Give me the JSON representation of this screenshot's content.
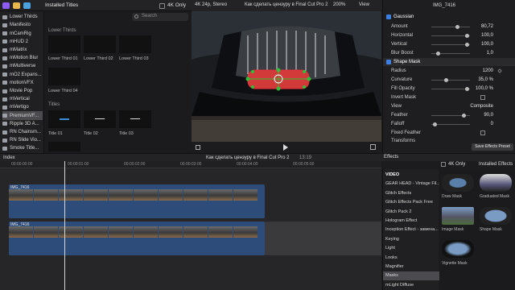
{
  "browser": {
    "title": "Installed Titles",
    "filter_label": "4K Only",
    "search_placeholder": "Search",
    "section_lower_thirds": "Lower Thirds",
    "section_titles": "Titles",
    "lower_thirds": [
      "Lower Third 01",
      "Lower Third 02",
      "Lower Third 03",
      "Lower Third 04"
    ],
    "titles": [
      "Title 01",
      "Title 02",
      "Title 03"
    ]
  },
  "sidebar": {
    "items": [
      "Lower Thirds",
      "Manifesto",
      "mCamRig",
      "mHUD 2",
      "mMatrix",
      "mMotion Blur",
      "mMultiverse",
      "mO2 Expans...",
      "motionVFX",
      "Movie Pop",
      "mVertical",
      "mVertigo",
      "PremiumVF...",
      "Ripple 3D A...",
      "RN Chainsm...",
      "RN Slide Vio...",
      "Smoke Title..."
    ],
    "selected_index": 12
  },
  "viewer": {
    "format": "4K 24p, Stereo",
    "clip_name": "Как сделать цензуру в Final Cut Pro 2",
    "zoom": "200%",
    "view_label": "View"
  },
  "inspector": {
    "clip_name": "IMG_7416",
    "gaussian": {
      "title": "Gaussian",
      "amount_label": "Amount",
      "amount": "80,72",
      "horizontal_label": "Horizontal",
      "horizontal": "100,0",
      "vertical_label": "Vertical",
      "vertical": "100,0",
      "blur_boost_label": "Blur Boost",
      "blur_boost": "1,0"
    },
    "shape_mask": {
      "title": "Shape Mask",
      "radius_label": "Radius",
      "radius": "1200",
      "curvature_label": "Curvature",
      "curvature": "35,0 %",
      "fill_opacity_label": "Fill Opacity",
      "fill_opacity": "100,0 %",
      "invert_label": "Invert Mask",
      "view_label": "View",
      "view": "Composite",
      "feather_label": "Feather",
      "feather": "90,0",
      "falloff_label": "Falloff",
      "falloff": "0",
      "fixed_feather_label": "Fixed Feather"
    },
    "transforms": "Transforms",
    "save_preset": "Save Effects Preset"
  },
  "timeline": {
    "index_label": "Index",
    "project_name": "Как сделать цензуру в Final Cut Pro 2",
    "duration": "13:19",
    "ticks": [
      "00:00:00:00",
      "00:00:01:00",
      "00:00:02:00",
      "00:00:03:00",
      "00:00:04:00",
      "00:00:05:00"
    ],
    "clip1": "IMG_7416",
    "clip2": "IMG_7416"
  },
  "effects": {
    "title": "Effects",
    "filter_label": "4K Only",
    "installed_label": "Installed Effects",
    "categories": [
      "VIDEO",
      "GEAR HEAD - Vintage Fil...",
      "Glitch Effects",
      "Glitch Effects Pack Free",
      "Glitch Pack 2",
      "Hologram Effect",
      "Inception Effect - замена...",
      "Keying",
      "Light",
      "Looks",
      "Magnifier",
      "Masks",
      "mLight Diffuse"
    ],
    "selected_index": 11,
    "items": [
      "Draw Mask",
      "Graduated Mask",
      "Image Mask",
      "Shape Mask",
      "Vignette Mask"
    ]
  },
  "colors": {
    "accent": "#3d7fe0",
    "mask_green": "#2fbf3a",
    "mask_red": "#e0303a",
    "clip_blue": "#2e4c7a"
  }
}
